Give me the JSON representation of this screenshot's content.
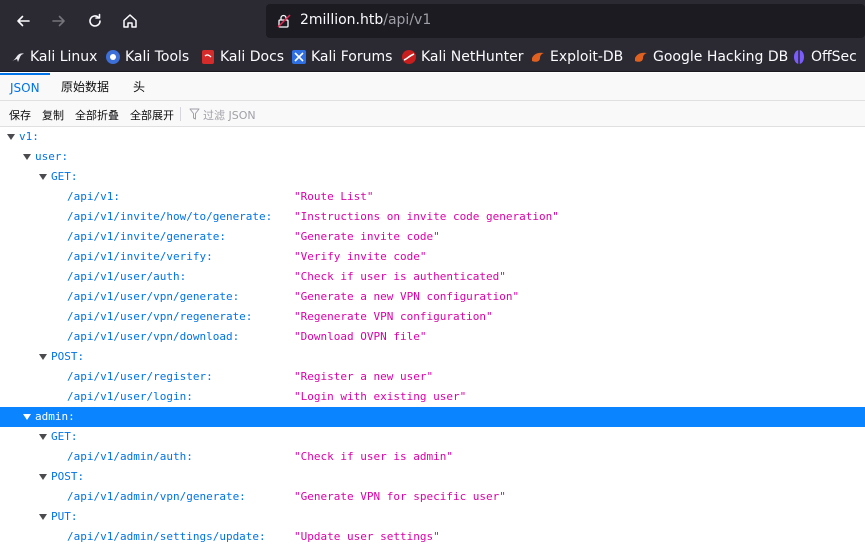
{
  "browser": {
    "url_host": "2million.htb",
    "url_path": "/api/v1"
  },
  "bookmarks": [
    {
      "label": "Kali Linux",
      "icon": "kali-dragon-icon",
      "color": "#111111"
    },
    {
      "label": "Kali Tools",
      "icon": "kali-tools-icon",
      "color": "#3c6fd8"
    },
    {
      "label": "Kali Docs",
      "icon": "kali-docs-icon",
      "color": "#d62b2b"
    },
    {
      "label": "Kali Forums",
      "icon": "kali-forums-icon",
      "color": "#2f6fe4"
    },
    {
      "label": "Kali NetHunter",
      "icon": "nethunter-icon",
      "color": "#c81e1e"
    },
    {
      "label": "Exploit-DB",
      "icon": "exploit-db-icon",
      "color": "#e06020"
    },
    {
      "label": "Google Hacking DB",
      "icon": "ghdb-icon",
      "color": "#e06020"
    },
    {
      "label": "OffSec",
      "icon": "offsec-icon",
      "color": "#7b5cff"
    }
  ],
  "viewer": {
    "tabs": [
      "JSON",
      "原始数据",
      "头"
    ],
    "active_tab": "JSON",
    "toolbar": {
      "save": "保存",
      "copy": "复制",
      "collapse_all": "全部折叠",
      "expand_all": "全部展开",
      "filter_placeholder": "过滤 JSON"
    }
  },
  "tree": [
    {
      "key": "v1:",
      "value": "",
      "depth": 0,
      "expandable": true,
      "selected": false
    },
    {
      "key": "user:",
      "value": "",
      "depth": 1,
      "expandable": true,
      "selected": false
    },
    {
      "key": "GET:",
      "value": "",
      "depth": 2,
      "expandable": true,
      "selected": false
    },
    {
      "key": "/api/v1:",
      "value": "\"Route List\"",
      "depth": 3,
      "expandable": false,
      "selected": false
    },
    {
      "key": "/api/v1/invite/how/to/generate:",
      "value": "\"Instructions on invite code generation\"",
      "depth": 3,
      "expandable": false,
      "selected": false
    },
    {
      "key": "/api/v1/invite/generate:",
      "value": "\"Generate invite code\"",
      "depth": 3,
      "expandable": false,
      "selected": false
    },
    {
      "key": "/api/v1/invite/verify:",
      "value": "\"Verify invite code\"",
      "depth": 3,
      "expandable": false,
      "selected": false
    },
    {
      "key": "/api/v1/user/auth:",
      "value": "\"Check if user is authenticated\"",
      "depth": 3,
      "expandable": false,
      "selected": false
    },
    {
      "key": "/api/v1/user/vpn/generate:",
      "value": "\"Generate a new VPN configuration\"",
      "depth": 3,
      "expandable": false,
      "selected": false
    },
    {
      "key": "/api/v1/user/vpn/regenerate:",
      "value": "\"Regenerate VPN configuration\"",
      "depth": 3,
      "expandable": false,
      "selected": false
    },
    {
      "key": "/api/v1/user/vpn/download:",
      "value": "\"Download OVPN file\"",
      "depth": 3,
      "expandable": false,
      "selected": false
    },
    {
      "key": "POST:",
      "value": "",
      "depth": 2,
      "expandable": true,
      "selected": false
    },
    {
      "key": "/api/v1/user/register:",
      "value": "\"Register a new user\"",
      "depth": 3,
      "expandable": false,
      "selected": false
    },
    {
      "key": "/api/v1/user/login:",
      "value": "\"Login with existing user\"",
      "depth": 3,
      "expandable": false,
      "selected": false
    },
    {
      "key": "admin:",
      "value": "",
      "depth": 1,
      "expandable": true,
      "selected": true
    },
    {
      "key": "GET:",
      "value": "",
      "depth": 2,
      "expandable": true,
      "selected": false
    },
    {
      "key": "/api/v1/admin/auth:",
      "value": "\"Check if user is admin\"",
      "depth": 3,
      "expandable": false,
      "selected": false
    },
    {
      "key": "POST:",
      "value": "",
      "depth": 2,
      "expandable": true,
      "selected": false
    },
    {
      "key": "/api/v1/admin/vpn/generate:",
      "value": "\"Generate VPN for specific user\"",
      "depth": 3,
      "expandable": false,
      "selected": false
    },
    {
      "key": "PUT:",
      "value": "",
      "depth": 2,
      "expandable": true,
      "selected": false
    },
    {
      "key": "/api/v1/admin/settings/update:",
      "value": "\"Update user settings\"",
      "depth": 3,
      "expandable": false,
      "selected": false
    }
  ]
}
